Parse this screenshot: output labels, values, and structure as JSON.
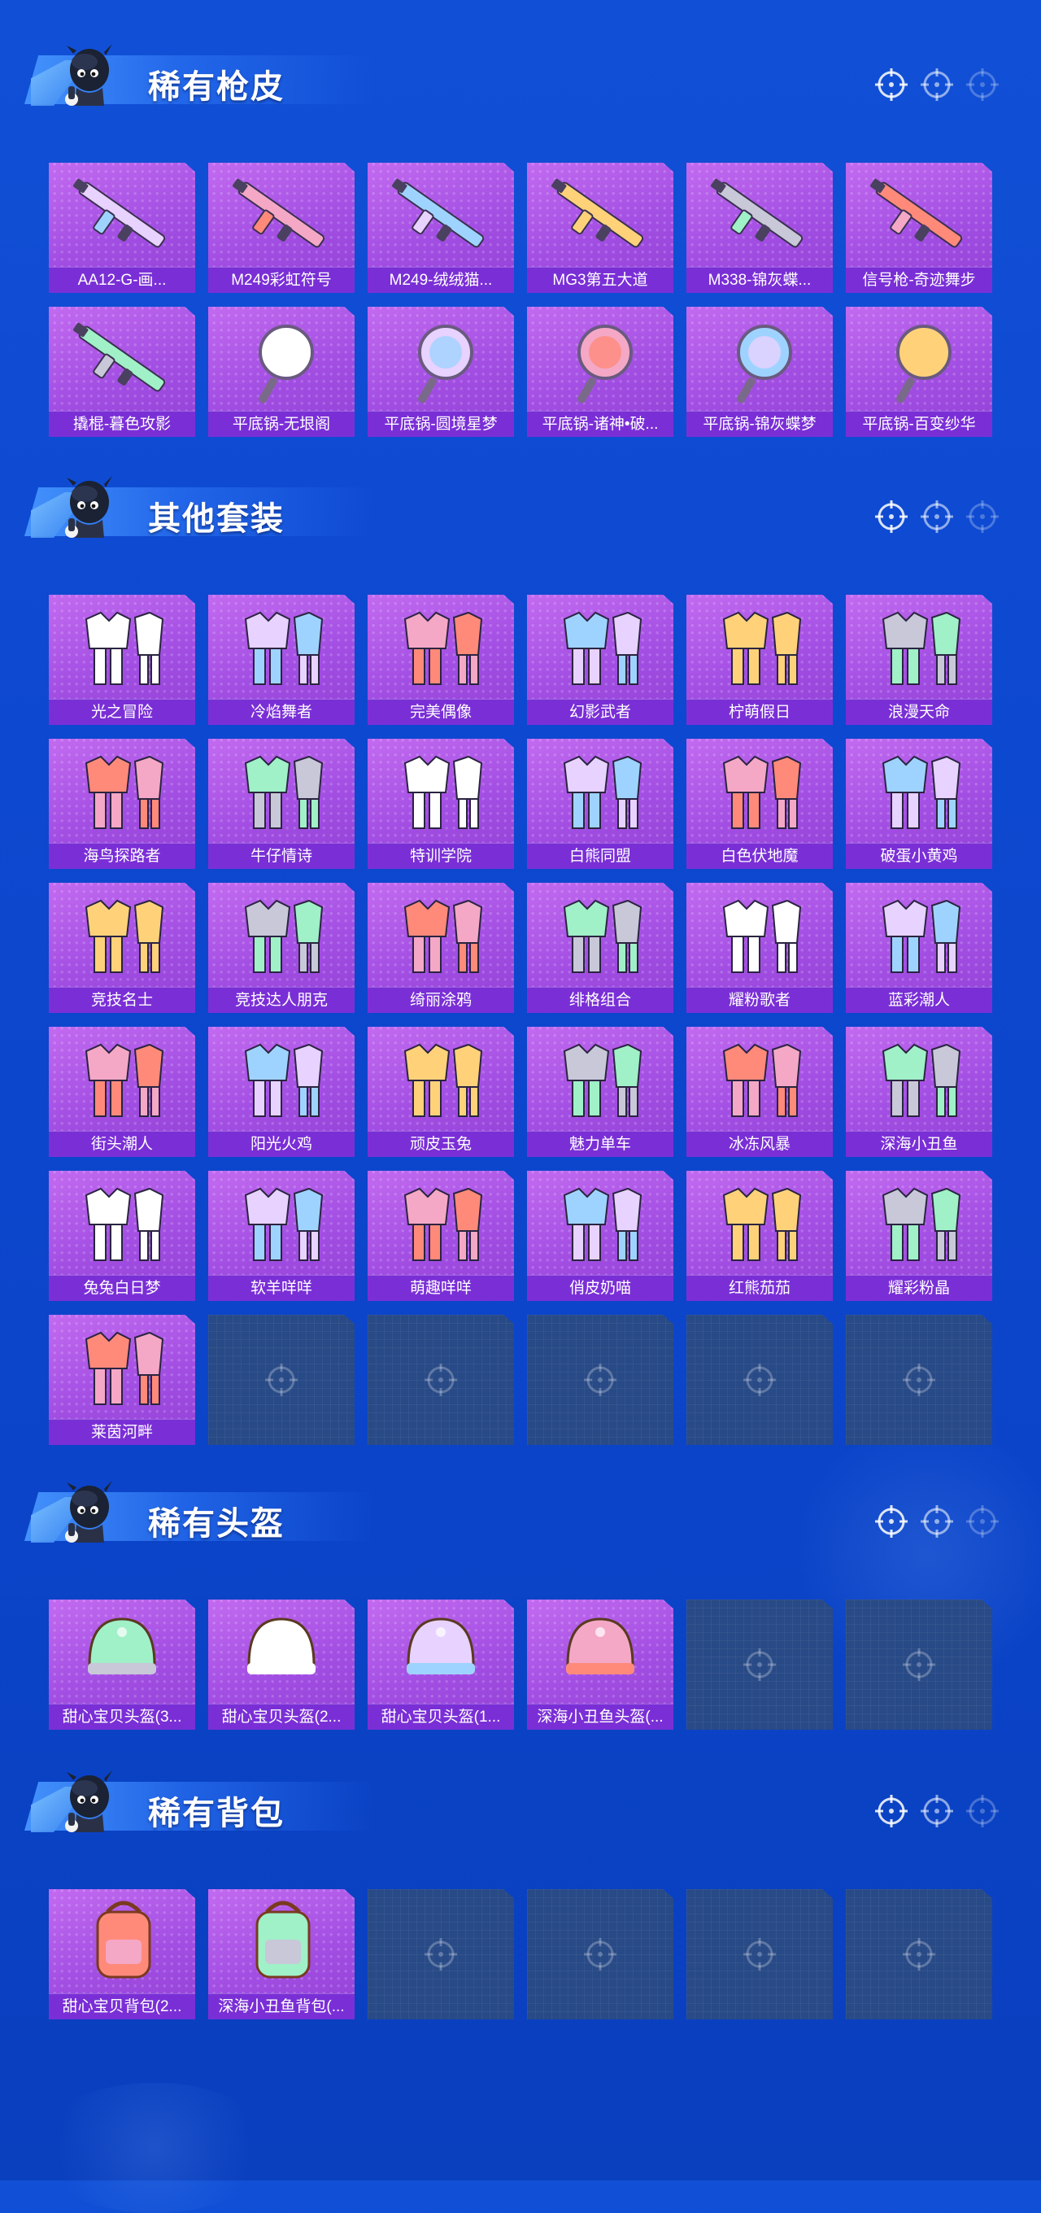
{
  "sections": [
    {
      "title": "稀有枪皮",
      "items": [
        {
          "label": "AA12-G-画...",
          "icon": "shotgun-skin-icon"
        },
        {
          "label": "M249彩虹符号",
          "icon": "machine-gun-skin-icon"
        },
        {
          "label": "M249-绒绒猫...",
          "icon": "machine-gun-skin-icon"
        },
        {
          "label": "MG3第五大道",
          "icon": "machine-gun-skin-icon"
        },
        {
          "label": "M338-锦灰蝶...",
          "icon": "rifle-skin-icon"
        },
        {
          "label": "信号枪-奇迹舞步",
          "icon": "flare-gun-skin-icon"
        },
        {
          "label": "撬棍-暮色攻影",
          "icon": "crowbar-skin-icon"
        },
        {
          "label": "平底锅-无垠阁",
          "icon": "pan-skin-icon"
        },
        {
          "label": "平底锅-圆境星梦",
          "icon": "pan-skin-icon"
        },
        {
          "label": "平底锅-诸神•破...",
          "icon": "pan-skin-icon"
        },
        {
          "label": "平底锅-锦灰蝶梦",
          "icon": "pan-skin-icon"
        },
        {
          "label": "平底锅-百变纱华",
          "icon": "pan-skin-icon"
        }
      ],
      "empty_slots": 0
    },
    {
      "title": "其他套装",
      "items": [
        {
          "label": "光之冒险",
          "icon": "outfit-icon"
        },
        {
          "label": "冷焰舞者",
          "icon": "outfit-icon"
        },
        {
          "label": "完美偶像",
          "icon": "outfit-icon"
        },
        {
          "label": "幻影武者",
          "icon": "outfit-icon"
        },
        {
          "label": "柠萌假日",
          "icon": "outfit-icon"
        },
        {
          "label": "浪漫天命",
          "icon": "outfit-icon"
        },
        {
          "label": "海鸟探路者",
          "icon": "outfit-icon"
        },
        {
          "label": "牛仔情诗",
          "icon": "outfit-icon"
        },
        {
          "label": "特训学院",
          "icon": "outfit-icon"
        },
        {
          "label": "白熊同盟",
          "icon": "outfit-icon"
        },
        {
          "label": "白色伏地魔",
          "icon": "outfit-icon"
        },
        {
          "label": "破蛋小黄鸡",
          "icon": "outfit-icon"
        },
        {
          "label": "竞技名士",
          "icon": "outfit-icon"
        },
        {
          "label": "竞技达人朋克",
          "icon": "outfit-icon"
        },
        {
          "label": "绮丽涂鸦",
          "icon": "outfit-icon"
        },
        {
          "label": "绯格组合",
          "icon": "outfit-icon"
        },
        {
          "label": "耀粉歌者",
          "icon": "outfit-icon"
        },
        {
          "label": "蓝彩潮人",
          "icon": "outfit-icon"
        },
        {
          "label": "街头潮人",
          "icon": "outfit-icon"
        },
        {
          "label": "阳光火鸡",
          "icon": "outfit-icon"
        },
        {
          "label": "顽皮玉兔",
          "icon": "outfit-icon"
        },
        {
          "label": "魅力单车",
          "icon": "outfit-icon"
        },
        {
          "label": "冰冻风暴",
          "icon": "outfit-icon"
        },
        {
          "label": "深海小丑鱼",
          "icon": "outfit-icon"
        },
        {
          "label": "兔兔白日梦",
          "icon": "outfit-icon"
        },
        {
          "label": "软羊咩咩",
          "icon": "outfit-icon"
        },
        {
          "label": "萌趣咩咩",
          "icon": "outfit-icon"
        },
        {
          "label": "俏皮奶喵",
          "icon": "outfit-icon"
        },
        {
          "label": "红熊茄茄",
          "icon": "outfit-icon"
        },
        {
          "label": "耀彩粉晶",
          "icon": "outfit-icon"
        },
        {
          "label": "莱茵河畔",
          "icon": "outfit-icon"
        }
      ],
      "empty_slots": 5
    },
    {
      "title": "稀有头盔",
      "items": [
        {
          "label": "甜心宝贝头盔(3...",
          "icon": "helmet-icon"
        },
        {
          "label": "甜心宝贝头盔(2...",
          "icon": "helmet-icon"
        },
        {
          "label": "甜心宝贝头盔(1...",
          "icon": "helmet-icon"
        },
        {
          "label": "深海小丑鱼头盔(...",
          "icon": "helmet-icon"
        }
      ],
      "empty_slots": 2
    },
    {
      "title": "稀有背包",
      "items": [
        {
          "label": "甜心宝贝背包(2...",
          "icon": "backpack-icon"
        },
        {
          "label": "深海小丑鱼背包(...",
          "icon": "backpack-icon"
        }
      ],
      "empty_slots": 4
    }
  ],
  "colors": {
    "card_fill": "#a24ee3",
    "label_bar": "#7a2fd6",
    "empty_slot": "#284a86",
    "background": "#0d48d0"
  }
}
